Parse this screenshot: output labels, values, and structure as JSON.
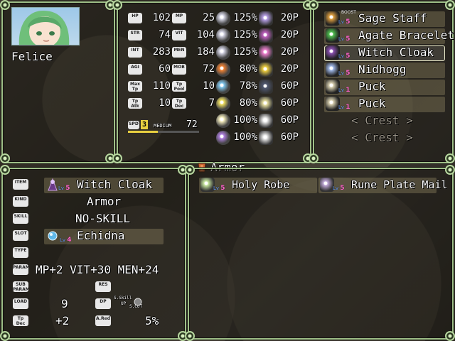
{
  "character": {
    "name": "Felice"
  },
  "stats": [
    {
      "tag": "HP",
      "value": "102"
    },
    {
      "tag": "MP",
      "value": "25"
    },
    {
      "tag": "STR",
      "value": "74"
    },
    {
      "tag": "VIT",
      "value": "104"
    },
    {
      "tag": "INT",
      "value": "283"
    },
    {
      "tag": "MEN",
      "value": "184"
    },
    {
      "tag": "AGI",
      "value": "60"
    },
    {
      "tag": "MOB",
      "value": "72"
    },
    {
      "tag": "Max Tp",
      "value": "110"
    },
    {
      "tag": "Tp Pool",
      "value": "10"
    },
    {
      "tag": "Tp Atk",
      "value": "10"
    },
    {
      "tag": "Tp Dec",
      "value": "7"
    }
  ],
  "speed": {
    "tag": "SPD",
    "level": "3",
    "label": "MEDIUM",
    "value": "72"
  },
  "resists": [
    {
      "icon": "slash-resist-icon",
      "pct": "125%",
      "pts_icon": "orb-cluster-icon",
      "pts": "20P"
    },
    {
      "icon": "pierce-resist-icon",
      "pct": "125%",
      "pts_icon": "poison-icon",
      "pts": "20P"
    },
    {
      "icon": "strike-resist-icon",
      "pct": "125%",
      "pts_icon": "charm-icon",
      "pts": "20P"
    },
    {
      "icon": "fire-icon",
      "pct": "80%",
      "pts_icon": "paralyze-icon",
      "pts": "20P"
    },
    {
      "icon": "ice-icon",
      "pct": "78%",
      "pts_icon": "dark-orb-icon",
      "pts": "60P"
    },
    {
      "icon": "thunder-icon",
      "pct": "80%",
      "pts_icon": "sleep-icon",
      "pts": "60P"
    },
    {
      "icon": "light-icon",
      "pct": "100%",
      "pts_icon": "confuse-icon",
      "pts": "60P"
    },
    {
      "icon": "dark-icon",
      "pct": "100%",
      "pts_icon": "silence-icon",
      "pts": "60P"
    }
  ],
  "equipment": [
    {
      "name": "Sage Staff",
      "lv": "5",
      "boost": "BOOST",
      "icon": "staff-icon"
    },
    {
      "name": "Agate Bracelet",
      "lv": "5",
      "icon": "bracelet-icon"
    },
    {
      "name": "Witch Cloak",
      "lv": "5",
      "icon": "cloak-icon"
    },
    {
      "name": "Nidhogg",
      "lv": "5",
      "icon": "crystal-icon"
    },
    {
      "name": "Puck",
      "lv": "1",
      "icon": "stone-icon"
    },
    {
      "name": "Puck",
      "lv": "1",
      "icon": "stone-icon"
    },
    {
      "name": "< Crest >"
    },
    {
      "name": "< Crest >"
    }
  ],
  "category": {
    "label": "Armor"
  },
  "detail": {
    "item_tag": "ITEM",
    "item_name": "Witch Cloak",
    "item_lv": "5",
    "kind_tag": "KIND",
    "kind": "Armor",
    "skill_tag": "SKILL",
    "skill": "NO-SKILL",
    "slot_tag": "SLOT",
    "slot": "Echidna",
    "slot_lv": "4",
    "type_tag": "TYPE",
    "param_tag": "PARAM",
    "param": "MP+2 VIT+30 MEN+24",
    "subparam_tag": "SUB PARAM",
    "res_tag": "RES",
    "load_tag": "LOAD",
    "load": "9",
    "dp_tag": "DP",
    "skill_up_1": "S.Skill",
    "skill_up_2": "UP",
    "skill_up_3": "S.CUT",
    "tpdec_tag": "Tp Dec",
    "tpdec": "+2",
    "ared_tag": "A.Red",
    "ared": "5%"
  },
  "list": [
    {
      "name": "Holy Robe",
      "lv": "5",
      "icon": "robe-icon"
    },
    {
      "name": "Rune Plate Mail",
      "lv": "5",
      "icon": "plate-icon"
    }
  ],
  "colors": {
    "frame": "#9fc088",
    "highlight": "#a09670",
    "lv_blue": "#6aa0ff",
    "lv_pink": "#ff66cc"
  }
}
